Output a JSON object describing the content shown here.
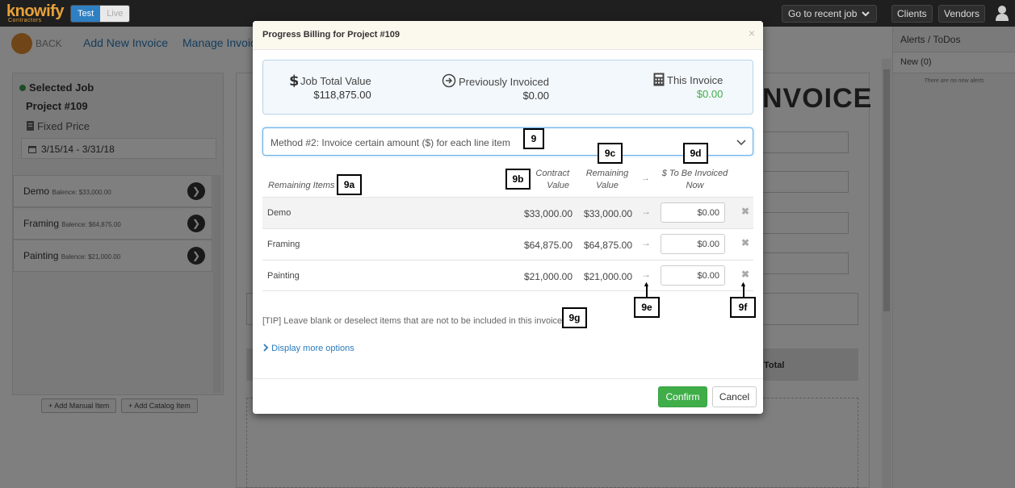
{
  "topbar": {
    "logo": "knowify",
    "logo_sub": "Contractors",
    "toggle_test": "Test",
    "toggle_live": "Live",
    "recent_job": "Go to recent job",
    "clients": "Clients",
    "vendors": "Vendors"
  },
  "nav": {
    "back": "BACK",
    "add_invoice": "Add New Invoice",
    "manage_invoices": "Manage Invoic"
  },
  "left_panel": {
    "title": "Selected Job",
    "project": "Project #109",
    "price_type": "Fixed Price",
    "dates": "3/15/14 - 3/31/18",
    "items": [
      {
        "name": "Demo",
        "balance": "Balence: $33,000.00"
      },
      {
        "name": "Framing",
        "balance": "Balence: $64,875.00"
      },
      {
        "name": "Painting",
        "balance": "Balence: $21,000.00"
      }
    ],
    "add_manual": "+ Add Manual Item",
    "add_catalog": "+ Add Catalog Item"
  },
  "main": {
    "invoice_heading": "NVOICE",
    "total_label": "Total"
  },
  "right_panel": {
    "title": "Alerts / ToDos",
    "new": "New (0)",
    "none": "There are no new alerts"
  },
  "modal": {
    "title": "Progress Billing for Project #109",
    "close": "×",
    "summary": {
      "job_total_label": "Job Total Value",
      "job_total_value": "$118,875.00",
      "prev_label": "Previously Invoiced",
      "prev_value": "$0.00",
      "this_label": "This Invoice",
      "this_value": "$0.00"
    },
    "method": "Method #2: Invoice certain amount ($) for each line item",
    "headers": {
      "remaining_items": "Remaining Items",
      "contract_1": "Contract",
      "contract_2": "Value",
      "remaining_1": "Remaining",
      "remaining_2": "Value",
      "arrow": "→",
      "tobe_1": "$ To Be Invoiced",
      "tobe_2": "Now"
    },
    "rows": [
      {
        "name": "Demo",
        "contract": "$33,000.00",
        "remaining": "$33,000.00",
        "amount": "$0.00"
      },
      {
        "name": "Framing",
        "contract": "$64,875.00",
        "remaining": "$64,875.00",
        "amount": "$0.00"
      },
      {
        "name": "Painting",
        "contract": "$21,000.00",
        "remaining": "$21,000.00",
        "amount": "$0.00"
      }
    ],
    "tip": "[TIP] Leave blank or deselect items that are not to be included in this invoice",
    "more_options": "Display more options",
    "confirm": "Confirm",
    "cancel": "Cancel"
  },
  "tags": {
    "t9": "9",
    "t9a": "9a",
    "t9b": "9b",
    "t9c": "9c",
    "t9d": "9d",
    "t9e": "9e",
    "t9f": "9f",
    "t9g": "9g"
  },
  "colors": {
    "accent_blue": "#2b7bbb",
    "confirm_green": "#3fae49",
    "this_invoice_green": "#3fae49",
    "logo_orange": "#e8a13a"
  }
}
